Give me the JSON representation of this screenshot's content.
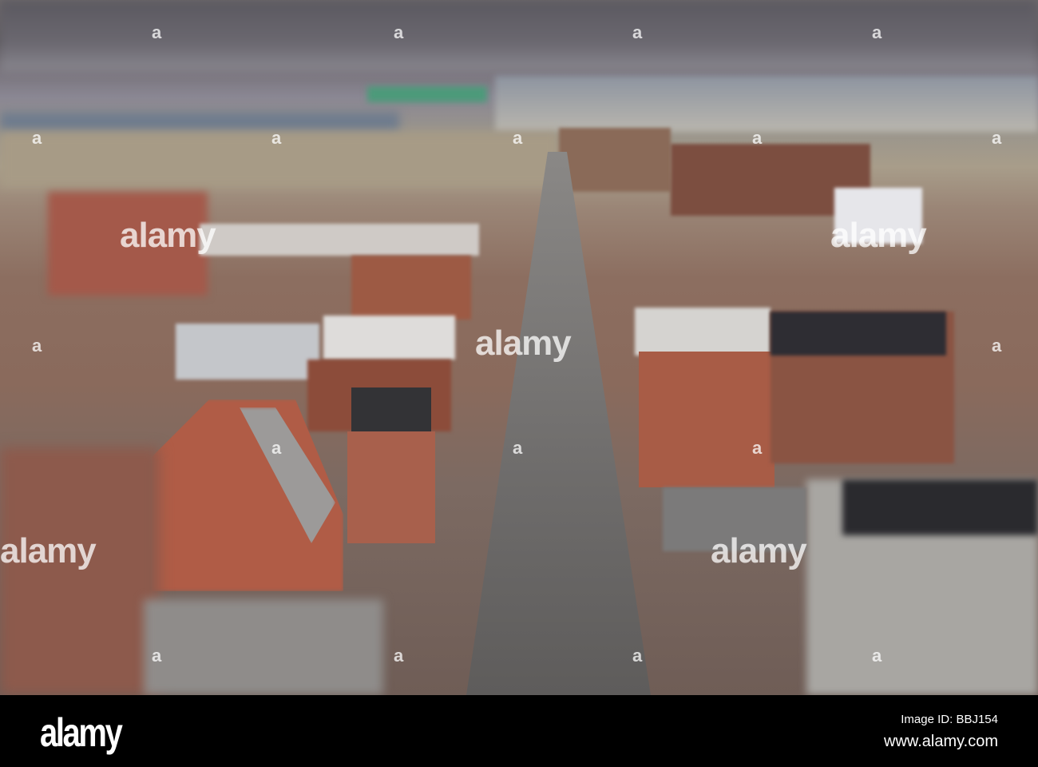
{
  "watermark": {
    "logo_text": "alamy",
    "mark": "a"
  },
  "footer": {
    "logo": "alamy",
    "image_id": "Image ID: BBJ154",
    "website": "www.alamy.com"
  }
}
